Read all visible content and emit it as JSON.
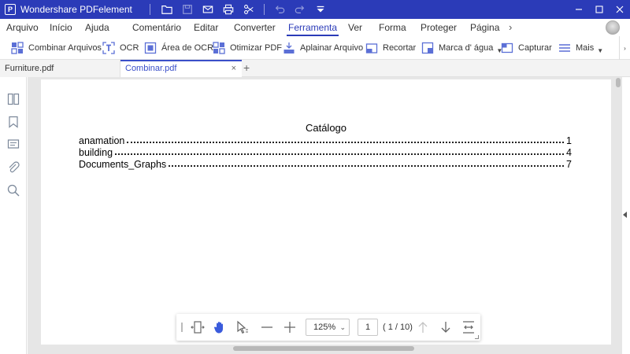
{
  "app": {
    "title": "Wondershare PDFelement",
    "logo_glyph": "P"
  },
  "menu": {
    "items": [
      {
        "label": "Arquivo"
      },
      {
        "label": "Início"
      },
      {
        "label": "Ajuda"
      },
      {
        "label": "Comentário"
      },
      {
        "label": "Editar"
      },
      {
        "label": "Converter"
      },
      {
        "label": "Ferramenta"
      },
      {
        "label": "Ver"
      },
      {
        "label": "Forma"
      },
      {
        "label": "Proteger"
      },
      {
        "label": "Página"
      }
    ],
    "active": "Ferramenta",
    "more_glyph": "›"
  },
  "toolbar": {
    "tools": [
      {
        "label": "Combinar Arquivos",
        "icon": "combine-files-icon"
      },
      {
        "label": "OCR",
        "icon": "ocr-icon"
      },
      {
        "label": "Área de OCR",
        "icon": "ocr-area-icon"
      },
      {
        "label": "Otimizar PDF",
        "icon": "optimize-pdf-icon"
      },
      {
        "label": "Aplainar Arquivo",
        "icon": "flatten-file-icon"
      },
      {
        "label": "Recortar",
        "icon": "crop-icon"
      },
      {
        "label": "Marca d' água",
        "icon": "watermark-icon"
      },
      {
        "label": "Capturar",
        "icon": "capture-icon"
      },
      {
        "label": "Mais",
        "icon": "more-menu-icon"
      }
    ],
    "scroll_glyph": "›"
  },
  "tabs": [
    {
      "label": "Furniture.pdf"
    },
    {
      "label": "Combinar.pdf",
      "close": "×"
    }
  ],
  "tab_add": "+",
  "document": {
    "title": "Catálogo",
    "toc": [
      {
        "entry": "anamation",
        "page": "1"
      },
      {
        "entry": "building",
        "page": "4"
      },
      {
        "entry": "Documents_Graphs",
        "page": "7"
      }
    ]
  },
  "bottombar": {
    "zoom": "125%",
    "zoom_arrow": "⌄",
    "current_page": "1",
    "page_count": "( 1 / 10)"
  },
  "colors": {
    "accent": "#2b3bb8",
    "tab_active": "#3a4fc9",
    "hand_tool": "#3a5bdc"
  }
}
